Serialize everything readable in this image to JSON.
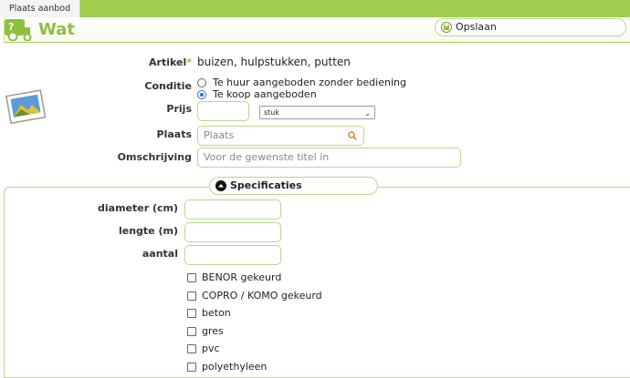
{
  "tabs": [
    {
      "label": "Plaats aanbod"
    }
  ],
  "section": {
    "title": "Wat"
  },
  "toolbar": {
    "save_label": "Opslaan"
  },
  "form": {
    "artikel_label": "Artikel",
    "required_mark": "*",
    "artikel_value": "buizen, hulpstukken, putten",
    "conditie_label": "Conditie",
    "conditie_options": [
      {
        "label": "Te huur aangeboden zonder bediening",
        "checked": false
      },
      {
        "label": "Te koop aangeboden",
        "checked": true
      }
    ],
    "prijs_label": "Prijs",
    "prijs_value": "",
    "unit_selected": "stuk",
    "plaats_label": "Plaats",
    "plaats_placeholder": "Plaats",
    "omschrijving_label": "Omschrijving",
    "omschrijving_placeholder": "Voor de gewenste titel in"
  },
  "specs": {
    "header": "Specificaties",
    "diameter_label": "diameter (cm)",
    "lengte_label": "lengte (m)",
    "aantal_label": "aantal",
    "checkboxes": [
      {
        "label": "BENOR gekeurd",
        "checked": false
      },
      {
        "label": "COPRO / KOMO gekeurd",
        "checked": false
      },
      {
        "label": "beton",
        "checked": false
      },
      {
        "label": "gres",
        "checked": false
      },
      {
        "label": "pvc",
        "checked": false
      },
      {
        "label": "polyethyleen",
        "checked": false
      }
    ]
  },
  "colors": {
    "accent": "#9fce4f",
    "title_green": "#8fbf3f",
    "border_green": "#b9d88d",
    "radio_blue": "#2b6fc9"
  },
  "icons": {
    "section": "tractor-question-icon",
    "save": "save-icon",
    "photo": "photo-icon",
    "search": "search-icon",
    "collapse": "chevron-up-icon"
  }
}
